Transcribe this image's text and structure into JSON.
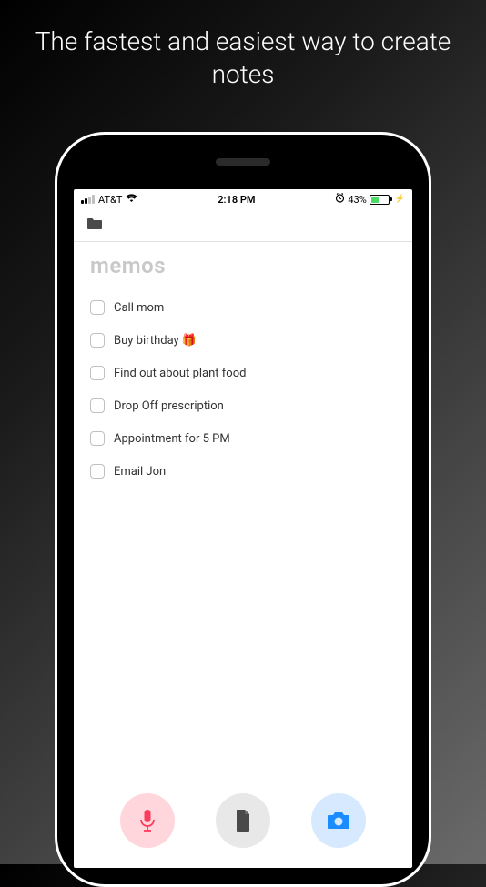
{
  "tagline": "The fastest and easiest way to create notes",
  "status": {
    "carrier": "AT&T",
    "time": "2:18 PM",
    "battery_pct": "43%"
  },
  "section_title": "memos",
  "memos": [
    {
      "text": "Call mom"
    },
    {
      "text": "Buy birthday 🎁"
    },
    {
      "text": "Find out about plant food"
    },
    {
      "text": "Drop Off prescription"
    },
    {
      "text": "Appointment for 5 PM"
    },
    {
      "text": "Email Jon"
    }
  ],
  "actions": {
    "mic": "voice-memo",
    "file": "text-memo",
    "camera": "photo-memo"
  }
}
